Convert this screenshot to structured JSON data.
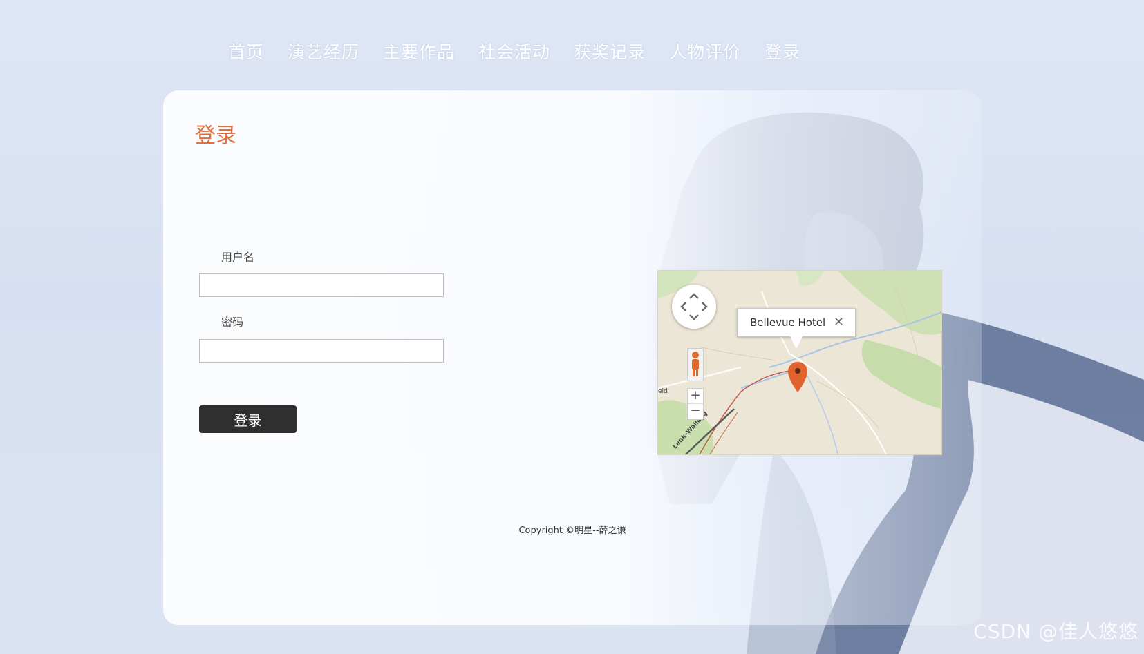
{
  "nav": {
    "items": [
      {
        "label": "首页"
      },
      {
        "label": "演艺经历"
      },
      {
        "label": "主要作品"
      },
      {
        "label": "社会活动"
      },
      {
        "label": "获奖记录"
      },
      {
        "label": "人物评价"
      },
      {
        "label": "登录"
      }
    ]
  },
  "login": {
    "title": "登录",
    "username_label": "用户名",
    "username_value": "",
    "password_label": "密码",
    "password_value": "",
    "submit_label": "登录"
  },
  "map": {
    "info_title": "Bellevue Hotel",
    "close_glyph": "✕",
    "zoom_in": "+",
    "zoom_out": "−",
    "road_label": "Lenk–Wallegg",
    "edge_label": "eld",
    "marker_color": "#e0622f"
  },
  "footer": {
    "copyright": "Copyright ©明星--薛之谦"
  },
  "watermark": "CSDN @佳人悠悠",
  "colors": {
    "title": "#e0703d",
    "button_bg": "#2f2f2f",
    "nav_text": "#ffffff"
  }
}
